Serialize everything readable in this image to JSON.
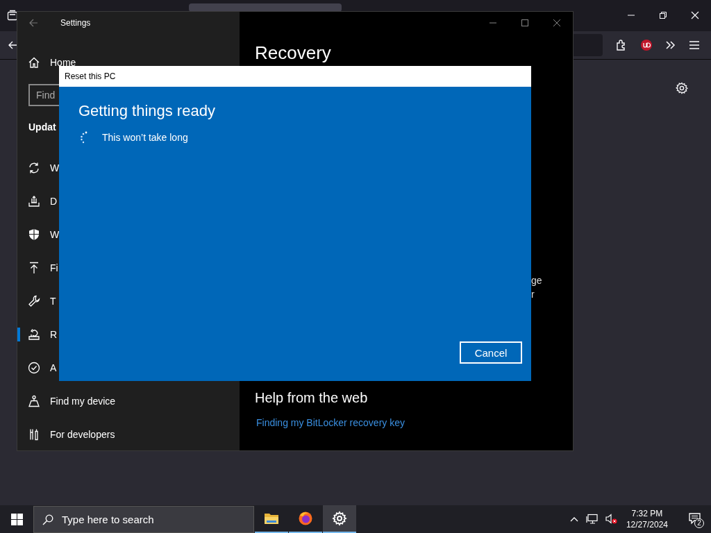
{
  "settings_window": {
    "title": "Settings",
    "home": "Home",
    "search": {
      "placeholder": "Find"
    },
    "section": "Updat",
    "items": [
      {
        "label": "W",
        "kind": "sync",
        "selected": false
      },
      {
        "label": "D",
        "kind": "delivery",
        "selected": false
      },
      {
        "label": "W",
        "kind": "shield",
        "selected": false
      },
      {
        "label": "Fi",
        "kind": "backup",
        "selected": false
      },
      {
        "label": "T",
        "kind": "wrench",
        "selected": false
      },
      {
        "label": "R",
        "kind": "recovery",
        "selected": true
      },
      {
        "label": "A",
        "kind": "check",
        "selected": false
      },
      {
        "label": "Find my device",
        "kind": "device",
        "selected": false
      },
      {
        "label": "For developers",
        "kind": "tools",
        "selected": false
      }
    ],
    "page": {
      "title": "Recovery",
      "fragments": [
        "ge",
        "r"
      ],
      "help_title": "Help from the web",
      "links": [
        "Finding my BitLocker recovery key"
      ]
    }
  },
  "dialog": {
    "title": "Reset this PC",
    "heading": "Getting things ready",
    "status": "This won’t take long",
    "buttons": [
      "Cancel"
    ]
  },
  "taskbar": {
    "search": {
      "placeholder": "Type here to search"
    },
    "apps": [
      {
        "kind": "files",
        "selected": false
      },
      {
        "kind": "browser",
        "selected": false
      },
      {
        "kind": "settings",
        "selected": true
      }
    ],
    "clock": {
      "time": "7:32 PM",
      "date": "12/27/2024"
    },
    "notifications": "2"
  }
}
